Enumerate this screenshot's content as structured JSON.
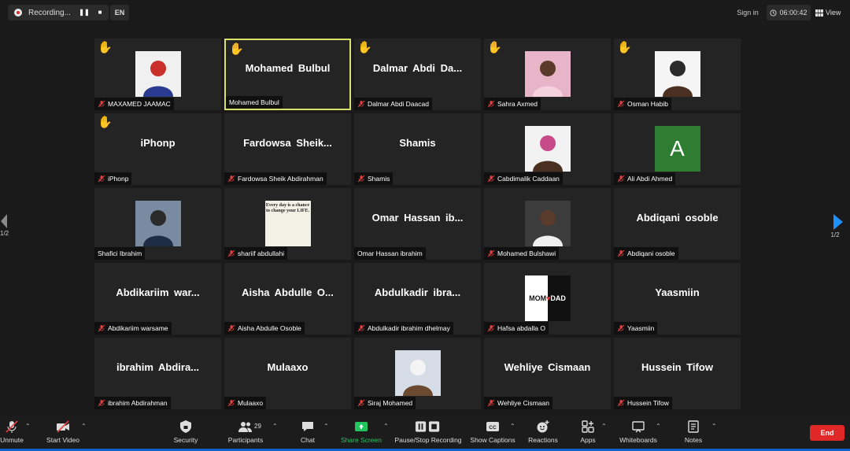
{
  "topbar": {
    "recording_label": "Recording...",
    "language": "EN",
    "sign_in": "Sign in",
    "timer": "06:00:42",
    "view_label": "View"
  },
  "pagination": {
    "left": "1/2",
    "right": "1/2"
  },
  "participants": [
    {
      "label": "MAXAMED JAAMAC",
      "display": "",
      "hand": true,
      "video": "photo-1"
    },
    {
      "label": "Mohamed Bulbul",
      "display": "Mohamed Bulbul",
      "hand": true,
      "active": true,
      "muted": false
    },
    {
      "label": "Dalmar Abdi Daacad",
      "display": "Dalmar Abdi Da...",
      "hand": true
    },
    {
      "label": "Sahra Axmed",
      "display": "",
      "hand": true,
      "video": "photo-2"
    },
    {
      "label": "Osman Habib",
      "display": "",
      "hand": true,
      "video": "photo-3"
    },
    {
      "label": "iPhonp",
      "display": "iPhonp",
      "hand": true
    },
    {
      "label": "Fardowsa Sheik Abdirahman",
      "display": "Fardowsa Sheik..."
    },
    {
      "label": "Shamis",
      "display": "Shamis"
    },
    {
      "label": "Cabdimalik Caddaan",
      "display": "",
      "video": "photo-4"
    },
    {
      "label": "Ali Abdi Ahmed",
      "display": "",
      "avatar_letter": "A"
    },
    {
      "label": "Shafici Ibrahim",
      "display": "",
      "video": "photo-5",
      "muted": false
    },
    {
      "label": "shariif abdullahi",
      "display": "",
      "quote": "Every day is a chance to change your LIFE."
    },
    {
      "label": "Omar Hassan ibrahim",
      "display": "Omar Hassan ib...",
      "muted": false
    },
    {
      "label": "Mohamed Bulshawi",
      "display": "",
      "video": "photo-6"
    },
    {
      "label": "Abdiqani osoble",
      "display": "Abdiqani osoble"
    },
    {
      "label": "Abdikariim warsame",
      "display": "Abdikariim war..."
    },
    {
      "label": "Aisha Abdulle Osoble",
      "display": "Aisha Abdulle O..."
    },
    {
      "label": "Abdulkadir ibrahim dhelmay",
      "display": "Abdulkadir ibra..."
    },
    {
      "label": "Hafsa abdalla O",
      "display": "",
      "momdad": {
        "mom": "MOM",
        "dad": "DAD"
      }
    },
    {
      "label": "Yaasmiin",
      "display": "Yaasmiin"
    },
    {
      "label": "ibrahim Abdirahman",
      "display": "ibrahim Abdira..."
    },
    {
      "label": "Mulaaxo",
      "display": "Mulaaxo"
    },
    {
      "label": "Siraj Mohamed",
      "display": "",
      "video": "photo-7"
    },
    {
      "label": "Wehliye Cismaan",
      "display": "Wehliye Cismaan"
    },
    {
      "label": "Hussein Tifow",
      "display": "Hussein Tifow"
    }
  ],
  "toolbar": {
    "unmute": "Unmute",
    "start_video": "Start Video",
    "security": "Security",
    "participants": "Participants",
    "participant_count": "29",
    "chat": "Chat",
    "share_screen": "Share Screen",
    "pause_stop_recording": "Pause/Stop Recording",
    "show_captions": "Show Captions",
    "reactions": "Reactions",
    "apps": "Apps",
    "whiteboards": "Whiteboards",
    "notes": "Notes",
    "end": "End"
  },
  "colors": {
    "active_border": "#d8e06a",
    "end_button": "#e02828",
    "share_green": "#21c55d",
    "raised_hand": "#f5c518",
    "muted_icon": "#e04040",
    "pagination_arrow": "#1e90ff"
  }
}
